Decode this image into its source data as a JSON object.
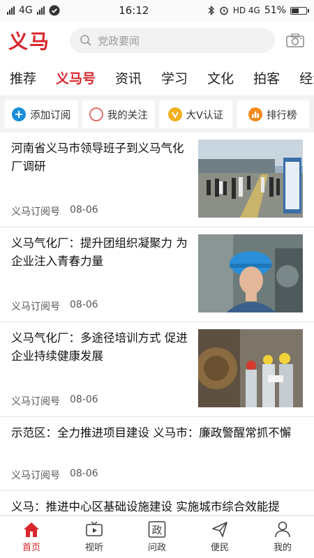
{
  "status_bar": {
    "carrier": "4G",
    "time": "16:12",
    "network": "HD 4G",
    "battery": "51%",
    "battery_level": 0.51
  },
  "header": {
    "logo": "义马",
    "search_placeholder": "党政要闻"
  },
  "tabs": [
    "推荐",
    "义马号",
    "资讯",
    "学习",
    "文化",
    "拍客",
    "经济"
  ],
  "active_tab": 1,
  "quick_actions": [
    {
      "label": "添加订阅",
      "icon": "plus-icon",
      "color": "#1a8fdd"
    },
    {
      "label": "我的关注",
      "icon": "circle-icon",
      "color": "#e06060"
    },
    {
      "label": "大V认证",
      "icon": "v-badge-icon",
      "color": "#f2b01e"
    },
    {
      "label": "排行榜",
      "icon": "ranking-icon",
      "color": "#f28a1e"
    }
  ],
  "articles": [
    {
      "title": "河南省义马市领导班子到义马气化厂调研",
      "source": "义马订阅号",
      "date": "08-06",
      "image": "photo-officials-visit"
    },
    {
      "title": "义马气化厂：提升团组织凝聚力 为企业注入青春力量",
      "source": "义马订阅号",
      "date": "08-06",
      "image": "photo-worker-helmet"
    },
    {
      "title": "义马气化厂：多途径培训方式 促进企业持续健康发展",
      "source": "义马订阅号",
      "date": "08-06",
      "image": "photo-training"
    },
    {
      "title": "示范区：全力推进项目建设 义马市：廉政警醒常抓不懈",
      "source": "义马订阅号",
      "date": "08-06",
      "image": ""
    },
    {
      "title": "义马：推进中心区基础设施建设 实施城市综合效能提",
      "source": "",
      "date": "",
      "image": ""
    }
  ],
  "bottom_nav": [
    {
      "label": "首页",
      "icon": "home-icon"
    },
    {
      "label": "视听",
      "icon": "tv-icon"
    },
    {
      "label": "问政",
      "icon": "politics-icon",
      "glyph": "政"
    },
    {
      "label": "便民",
      "icon": "send-icon"
    },
    {
      "label": "我的",
      "icon": "user-icon"
    }
  ],
  "active_nav": 0,
  "colors": {
    "accent": "#d8262b"
  }
}
